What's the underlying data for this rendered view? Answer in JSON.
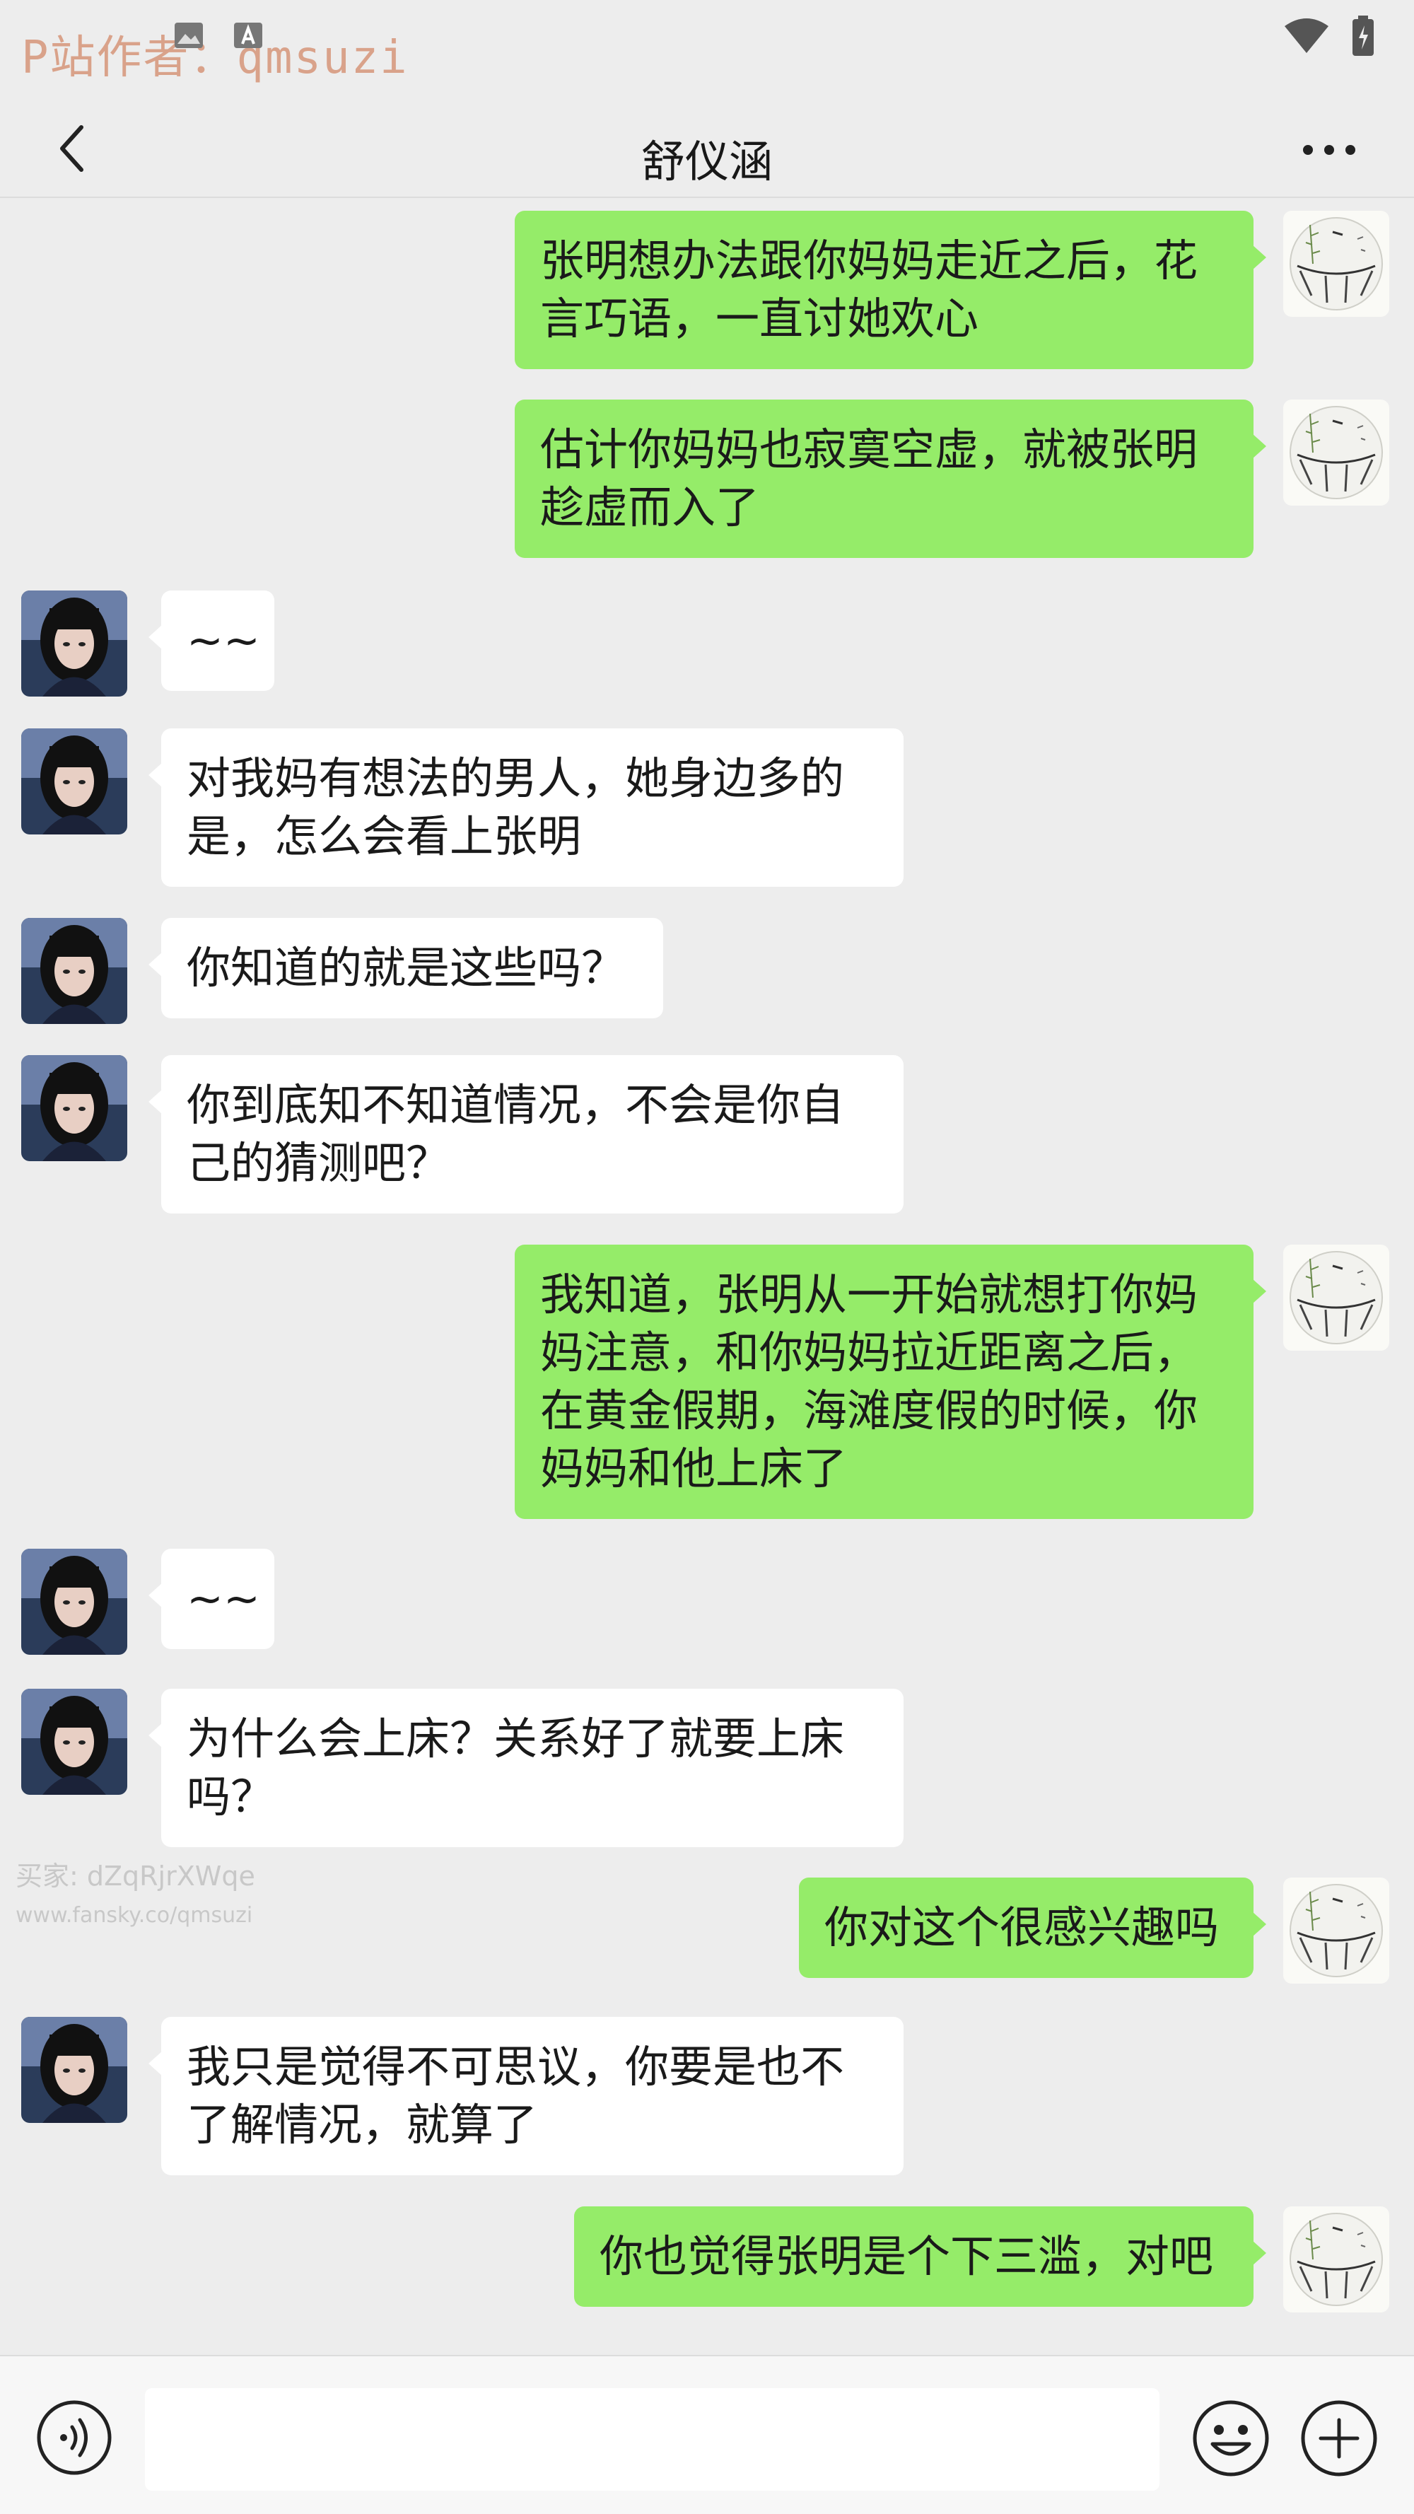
{
  "status_bar": {
    "watermark": "P站作者：qmsuzi"
  },
  "header": {
    "title": "舒仪涵"
  },
  "messages": [
    {
      "side": "out",
      "text": "张明想办法跟你妈妈走近之后，花言巧语，一直讨她欢心"
    },
    {
      "side": "out",
      "text": "估计你妈妈也寂寞空虚，就被张明趁虚而入了"
    },
    {
      "side": "in",
      "text": "~~"
    },
    {
      "side": "in",
      "text": "对我妈有想法的男人，她身边多的是，怎么会看上张明"
    },
    {
      "side": "in",
      "text": "你知道的就是这些吗？"
    },
    {
      "side": "in",
      "text": "你到底知不知道情况，不会是你自己的猜测吧？"
    },
    {
      "side": "out",
      "text": "我知道，张明从一开始就想打你妈妈注意，和你妈妈拉近距离之后，在黄金假期，海滩度假的时候，你妈妈和他上床了"
    },
    {
      "side": "in",
      "text": "~~"
    },
    {
      "side": "in",
      "text": "为什么会上床？关系好了就要上床吗？"
    },
    {
      "side": "out",
      "text": "你对这个很感兴趣吗"
    },
    {
      "side": "in",
      "text": "我只是觉得不可思议，你要是也不了解情况，就算了"
    },
    {
      "side": "out",
      "text": "你也觉得张明是个下三滥，对吧"
    }
  ],
  "watermark_mid": {
    "buyer": "买家: dZqRjrXWqe",
    "url": "www.fansky.co/qmsuzi"
  },
  "input_bar": {
    "value": ""
  },
  "colors": {
    "background": "#ededed",
    "outgoing_bubble": "#95ec69",
    "incoming_bubble": "#ffffff"
  }
}
